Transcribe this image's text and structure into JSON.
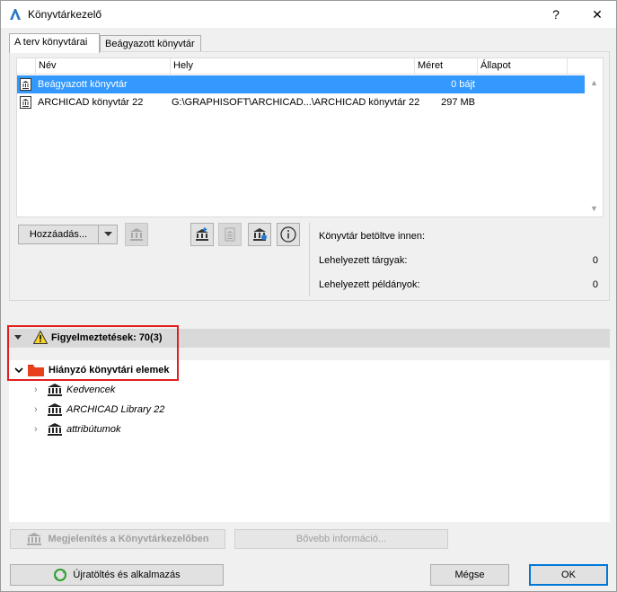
{
  "window": {
    "title": "Könyvtárkezelő"
  },
  "titlebar": {
    "help": "?",
    "close": "✕"
  },
  "tabs": [
    {
      "label": "A terv könyvtárai",
      "active": true
    },
    {
      "label": "Beágyazott könyvtár",
      "active": false
    }
  ],
  "table": {
    "columns": {
      "name": "Név",
      "location": "Hely",
      "size": "Méret",
      "status": "Állapot"
    },
    "rows": [
      {
        "name": "Beágyazott könyvtár",
        "location": "",
        "size": "0 bájt",
        "status": "",
        "selected": true
      },
      {
        "name": "ARCHICAD könyvtár 22",
        "location": "G:\\GRAPHISOFT\\ARCHICAD...\\ARCHICAD könyvtár 22",
        "size": "297 MB",
        "status": "",
        "selected": false
      }
    ]
  },
  "buttons": {
    "add": "Hozzáadás...",
    "show_in_manager": "Megjelenítés a Könyvtárkezelőben",
    "more_info": "Bővebb információ...",
    "reload": "Újratöltés és alkalmazás",
    "cancel": "Mégse",
    "ok": "OK"
  },
  "info": {
    "loaded_from_label": "Könyvtár betöltve innen:",
    "loaded_from_value": "",
    "placed_objects_label": "Lehelyezett tárgyak:",
    "placed_objects_value": "0",
    "placed_instances_label": "Lehelyezett példányok:",
    "placed_instances_value": "0"
  },
  "warnings": {
    "header": "Figyelmeztetések: 70(3)",
    "group": "Hiányzó könyvtári elemek",
    "items": [
      "Kedvencek",
      "ARCHICAD Library 22",
      "attribútumok"
    ]
  },
  "colors": {
    "selection": "#3399ff",
    "highlight": "#e02020",
    "folder": "#e8401c",
    "accent": "#0078d7"
  }
}
